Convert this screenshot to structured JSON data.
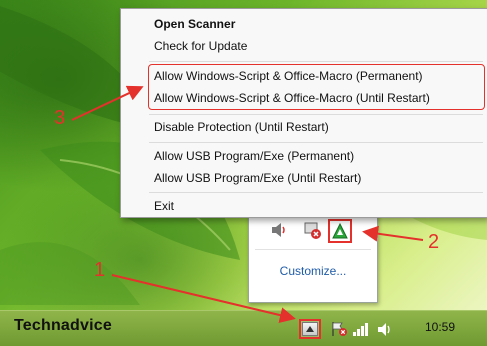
{
  "taskbar": {
    "brand": "Technadvice",
    "clock": "10:59"
  },
  "tray_overflow": {
    "customize_label": "Customize...",
    "icons": [
      "speaker-icon",
      "network-error-icon",
      "app-triangle-icon"
    ]
  },
  "context_menu": {
    "items": [
      {
        "label": "Open Scanner",
        "bold": true
      },
      {
        "label": "Check for Update"
      },
      {
        "label": "Allow Windows-Script & Office-Macro (Permanent)"
      },
      {
        "label": "Allow Windows-Script & Office-Macro (Until Restart)"
      },
      {
        "label": "Disable Protection (Until Restart)"
      },
      {
        "label": "Allow USB Program/Exe (Permanent)"
      },
      {
        "label": "Allow USB Program/Exe (Until Restart)"
      },
      {
        "label": "Exit"
      }
    ]
  },
  "annotations": [
    "1",
    "2",
    "3"
  ],
  "colors": {
    "annotation": "#e4312b",
    "link": "#1f5ca8",
    "app_icon": "#2aa63a"
  }
}
